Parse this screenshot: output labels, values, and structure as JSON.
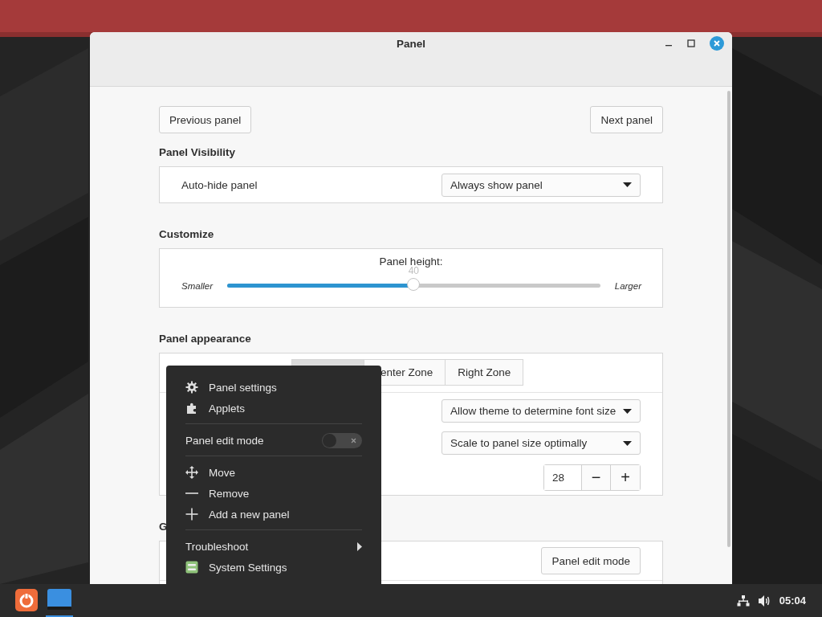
{
  "window": {
    "title": "Panel"
  },
  "nav_buttons": [
    "Previous panel",
    "Next panel"
  ],
  "visibility": {
    "heading": "Panel Visibility",
    "label": "Auto-hide panel",
    "value": "Always show panel"
  },
  "customize": {
    "heading": "Customize",
    "slider_label": "Panel height:",
    "min_label": "Smaller",
    "max_label": "Larger",
    "reading": "40",
    "level": 0.5
  },
  "appearance": {
    "heading": "Panel appearance",
    "tabs": [
      {
        "selected": true
      },
      {
        "label": "enter Zone",
        "selected": false
      },
      {
        "label": "Right Zone",
        "selected": false
      }
    ],
    "rows": [
      {
        "kind": "dropdown",
        "value": "Allow theme to determine font size"
      },
      {
        "kind": "dropdown",
        "value": "Scale to panel size optimally"
      },
      {
        "kind": "spin",
        "value": "28",
        "minus": "−",
        "plus": "+"
      }
    ]
  },
  "general": {
    "heading": "G",
    "button": "Panel edit mode"
  },
  "context_menu": {
    "items": [
      {
        "kind": "gear",
        "label": "Panel settings"
      },
      {
        "kind": "puzzle",
        "label": "Applets"
      },
      {
        "kind": "separator"
      },
      {
        "kind": "toggle",
        "label": "Panel edit mode",
        "on": false
      },
      {
        "kind": "separator"
      },
      {
        "kind": "move",
        "label": "Move"
      },
      {
        "kind": "minus",
        "label": "Remove"
      },
      {
        "kind": "plus",
        "label": "Add a new panel"
      },
      {
        "kind": "separator"
      },
      {
        "kind": "submenu",
        "label": "Troubleshoot"
      },
      {
        "kind": "settings",
        "label": "System Settings"
      }
    ]
  },
  "taskbar": {
    "apps": [
      {
        "active": false
      },
      {
        "active": true
      }
    ],
    "clock": "05:04"
  }
}
